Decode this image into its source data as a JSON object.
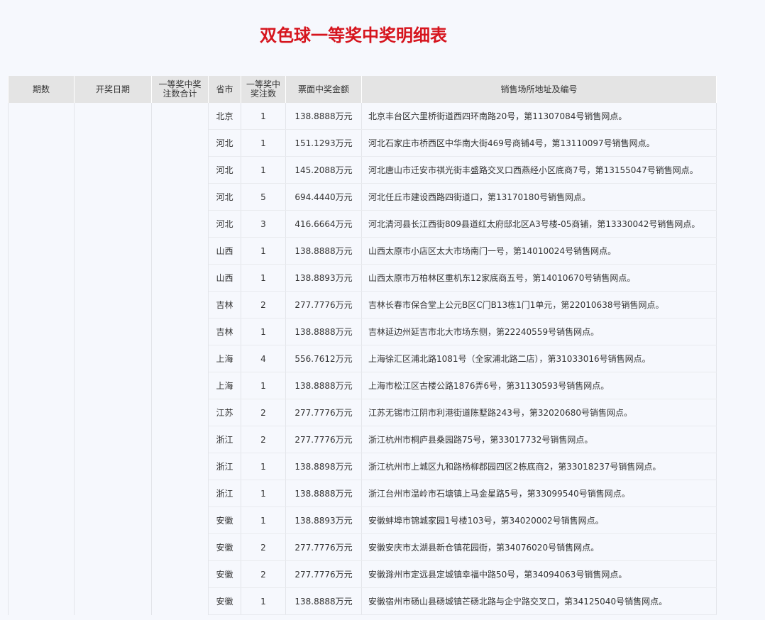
{
  "title": "双色球一等奖中奖明细表",
  "headers": {
    "period": "期数",
    "draw_date": "开奖日期",
    "total_bets": "一等奖中奖注数合计",
    "province": "省市",
    "bets": "一等奖中奖注数",
    "amount": "票面中奖金额",
    "address": "销售场所地址及编号"
  },
  "merged": {
    "period": "",
    "draw_date": "",
    "total_bets": ""
  },
  "rows": [
    {
      "province": "北京",
      "bets": "1",
      "amount": "138.8888万元",
      "address": "北京丰台区六里桥街道西四环南路20号，第11307084号销售网点。"
    },
    {
      "province": "河北",
      "bets": "1",
      "amount": "151.1293万元",
      "address": "河北石家庄市桥西区中华南大街469号商铺4号，第13110097号销售网点。"
    },
    {
      "province": "河北",
      "bets": "1",
      "amount": "145.2088万元",
      "address": "河北唐山市迁安市祺光街丰盛路交叉口西燕经小区底商7号，第13155047号销售网点。"
    },
    {
      "province": "河北",
      "bets": "5",
      "amount": "694.4440万元",
      "address": "河北任丘市建设西路四街道口，第13170180号销售网点。"
    },
    {
      "province": "河北",
      "bets": "3",
      "amount": "416.6664万元",
      "address": "河北清河县长江西街809县道红太府邸北区A3号楼-05商铺，第13330042号销售网点。"
    },
    {
      "province": "山西",
      "bets": "1",
      "amount": "138.8888万元",
      "address": "山西太原市小店区太大市场南门一号，第14010024号销售网点。"
    },
    {
      "province": "山西",
      "bets": "1",
      "amount": "138.8893万元",
      "address": "山西太原市万柏林区重机东12家底商五号，第14010670号销售网点。"
    },
    {
      "province": "吉林",
      "bets": "2",
      "amount": "277.7776万元",
      "address": "吉林长春市保合堂上公元B区C门B13栋1门1单元，第22010638号销售网点。"
    },
    {
      "province": "吉林",
      "bets": "1",
      "amount": "138.8888万元",
      "address": "吉林延边州延吉市北大市场东侧，第22240559号销售网点。"
    },
    {
      "province": "上海",
      "bets": "4",
      "amount": "556.7612万元",
      "address": "上海徐汇区浦北路1081号（全家浦北路二店），第31033016号销售网点。"
    },
    {
      "province": "上海",
      "bets": "1",
      "amount": "138.8888万元",
      "address": "上海市松江区古楼公路1876弄6号，第31130593号销售网点。"
    },
    {
      "province": "江苏",
      "bets": "2",
      "amount": "277.7776万元",
      "address": "江苏无锡市江阴市利港街道陈墅路243号，第32020680号销售网点。"
    },
    {
      "province": "浙江",
      "bets": "2",
      "amount": "277.7776万元",
      "address": "浙江杭州市桐庐县桑园路75号，第33017732号销售网点。"
    },
    {
      "province": "浙江",
      "bets": "1",
      "amount": "138.8898万元",
      "address": "浙江杭州市上城区九和路杨柳郡园四区2栋底商2，第33018237号销售网点。"
    },
    {
      "province": "浙江",
      "bets": "1",
      "amount": "138.8888万元",
      "address": "浙江台州市温岭市石塘镇上马金星路5号，第33099540号销售网点。"
    },
    {
      "province": "安徽",
      "bets": "1",
      "amount": "138.8893万元",
      "address": "安徽蚌埠市锦城家园1号楼103号，第34020002号销售网点。"
    },
    {
      "province": "安徽",
      "bets": "2",
      "amount": "277.7776万元",
      "address": "安徽安庆市太湖县新仓镇花园街，第34076020号销售网点。"
    },
    {
      "province": "安徽",
      "bets": "2",
      "amount": "277.7776万元",
      "address": "安徽滁州市定远县定城镇幸福中路50号，第34094063号销售网点。"
    },
    {
      "province": "安徽",
      "bets": "1",
      "amount": "138.8888万元",
      "address": "安徽宿州市砀山县砀城镇芒砀北路与企宁路交叉口，第34125040号销售网点。"
    }
  ]
}
